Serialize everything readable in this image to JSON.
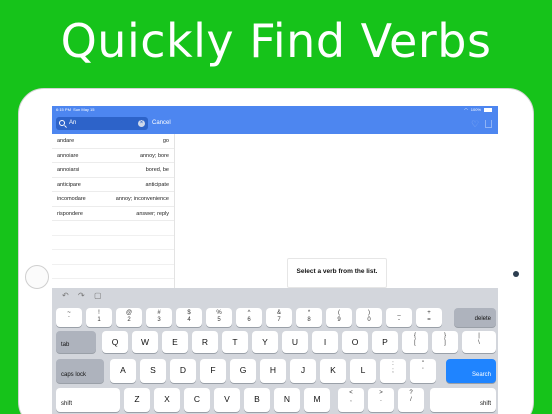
{
  "headline": "Quickly Find Verbs",
  "status": {
    "time": "6:15 PM",
    "date": "Sun May 15",
    "battery": "100%"
  },
  "search": {
    "value": "An",
    "cancel": "Cancel"
  },
  "list": [
    {
      "verb": "andare",
      "translation": "go"
    },
    {
      "verb": "annoiare",
      "translation": "annoy; bore"
    },
    {
      "verb": "annoiarsi",
      "translation": "bored, be"
    },
    {
      "verb": "anticipare",
      "translation": "anticipate"
    },
    {
      "verb": "incomodare",
      "translation": "annoy; inconvenience"
    },
    {
      "verb": "rispondere",
      "translation": "answer; reply"
    }
  ],
  "detail": {
    "placeholder": "Select a verb from the list."
  },
  "keyboard": {
    "row1": [
      [
        "~",
        "`"
      ],
      [
        "!",
        "1"
      ],
      [
        "@",
        "2"
      ],
      [
        "#",
        "3"
      ],
      [
        "%",
        "5"
      ],
      [
        "^",
        "6"
      ],
      [
        "&",
        "7"
      ],
      [
        "*",
        "8"
      ],
      [
        "(",
        "9"
      ],
      [
        ")",
        "0"
      ],
      [
        "_",
        "-"
      ],
      [
        "+",
        "="
      ]
    ],
    "row1_extra": [
      "$",
      "4"
    ],
    "delete": "delete",
    "tab": "tab",
    "row2": [
      "Q",
      "W",
      "E",
      "R",
      "T",
      "Y",
      "U",
      "I",
      "O",
      "P"
    ],
    "row2_sym": [
      [
        "{",
        "["
      ],
      [
        "}",
        "]"
      ],
      [
        "|",
        "\\"
      ]
    ],
    "caps": "caps lock",
    "row3": [
      "A",
      "S",
      "D",
      "F",
      "G",
      "H",
      "J",
      "K",
      "L"
    ],
    "row3_sym": [
      [
        ":",
        ";"
      ],
      [
        "\"",
        "'"
      ]
    ],
    "search_key": "Search",
    "shift": "shift",
    "row4": [
      "Z",
      "X",
      "C",
      "V",
      "B",
      "N",
      "M"
    ],
    "row4_sym": [
      [
        "<",
        ","
      ],
      [
        ">",
        "."
      ],
      [
        "?",
        "/"
      ]
    ]
  }
}
